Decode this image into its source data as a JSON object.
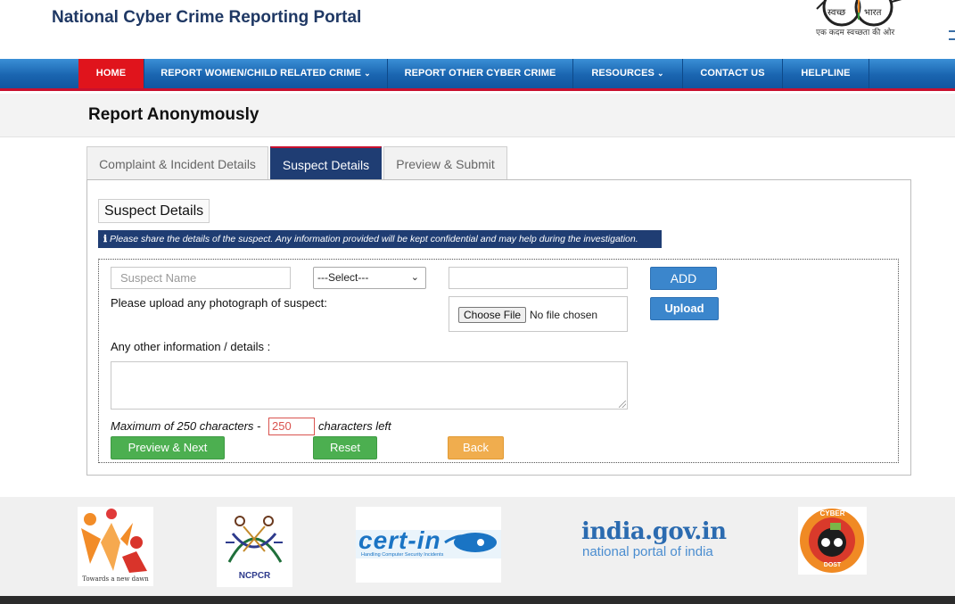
{
  "header": {
    "site_title": "National Cyber Crime Reporting Portal",
    "swachh_left": "स्वच्छ",
    "swachh_right": "भारत",
    "swachh_tagline": "एक कदम स्वच्छता की ओर"
  },
  "nav": {
    "items": [
      {
        "label": "HOME",
        "caret": ""
      },
      {
        "label": "REPORT WOMEN/CHILD RELATED CRIME",
        "caret": "⌄"
      },
      {
        "label": "REPORT OTHER CYBER CRIME",
        "caret": ""
      },
      {
        "label": "RESOURCES",
        "caret": "⌄"
      },
      {
        "label": "CONTACT US",
        "caret": ""
      },
      {
        "label": "HELPLINE",
        "caret": ""
      }
    ]
  },
  "page": {
    "title": "Report Anonymously"
  },
  "tabs": [
    {
      "label": "Complaint & Incident Details"
    },
    {
      "label": "Suspect Details"
    },
    {
      "label": "Preview & Submit"
    }
  ],
  "form": {
    "section_title": "Suspect Details",
    "info_icon": "ℹ",
    "info_text": "Please share the details of the suspect. Any information provided will be kept confidential and may help during the investigation.",
    "suspect_name_placeholder": "Suspect Name",
    "id_type_selected": "---Select---",
    "id_value": "",
    "add_label": "ADD",
    "photo_label": "Please upload any photograph of suspect:",
    "choose_file_label": "Choose File",
    "no_file_label": "No file chosen",
    "upload_label": "Upload",
    "other_info_label": "Any other information / details :",
    "max_chars_prefix": "Maximum of 250 characters -",
    "chars_left_value": "250",
    "chars_left_suffix": "characters left",
    "preview_next_label": "Preview & Next",
    "reset_label": "Reset",
    "back_label": "Back"
  },
  "footer": {
    "logo1_caption": "Towards a new dawn",
    "logo2_caption": "NCPCR",
    "logo3_name": "cert-in",
    "logo3_caption": "Handling Computer Security Incidents",
    "logo4_main": "india.gov.in",
    "logo4_sub": "national portal of india",
    "logo5_top": "CYBER",
    "logo5_bottom": "DOST"
  },
  "colors": {
    "nav_blue": "#1a65b0",
    "nav_active_red": "#e0141c",
    "tab_active_navy": "#1f3d73",
    "button_blue": "#3b86cc",
    "button_green": "#4caf50",
    "button_orange": "#f0ad4e"
  }
}
